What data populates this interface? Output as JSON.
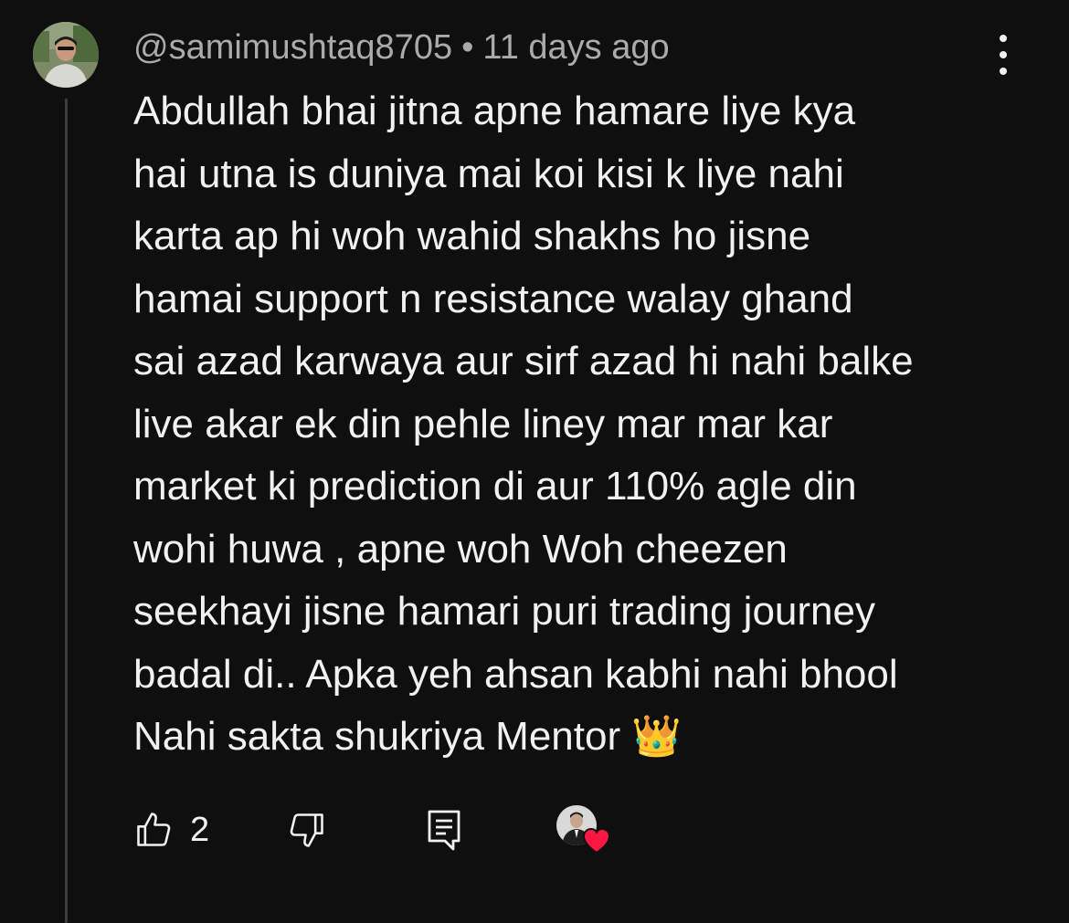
{
  "comment": {
    "author": "@samimushtaq8705",
    "separator": "•",
    "timestamp": "11 days ago",
    "text_lines": [
      "Abdullah bhai jitna apne hamare liye kya",
      "hai utna is duniya mai koi kisi k liye nahi",
      "karta ap hi woh wahid shakhs ho jisne",
      "hamai support n resistance walay ghand",
      "sai azad karwaya aur sirf azad hi nahi balke",
      "live akar ek din pehle liney mar mar kar",
      "market ki prediction di aur 110% agle din",
      "wohi huwa , apne woh Woh cheezen",
      "seekhayi jisne hamari puri trading journey",
      "badal di.. Apka yeh ahsan kabhi nahi bhool",
      "Nahi sakta shukriya Mentor 👑"
    ],
    "like_count": "2"
  },
  "icons": {
    "more": "more-vertical-icon",
    "like": "thumbs-up-icon",
    "dislike": "thumbs-down-icon",
    "reply": "reply-comment-icon",
    "heart": "creator-heart-icon"
  },
  "colors": {
    "background": "#0f0f0f",
    "text_primary": "#f1f1f1",
    "text_secondary": "#aaaaaa",
    "thread_line": "#3d3d3d",
    "heart": "#ff1744"
  }
}
